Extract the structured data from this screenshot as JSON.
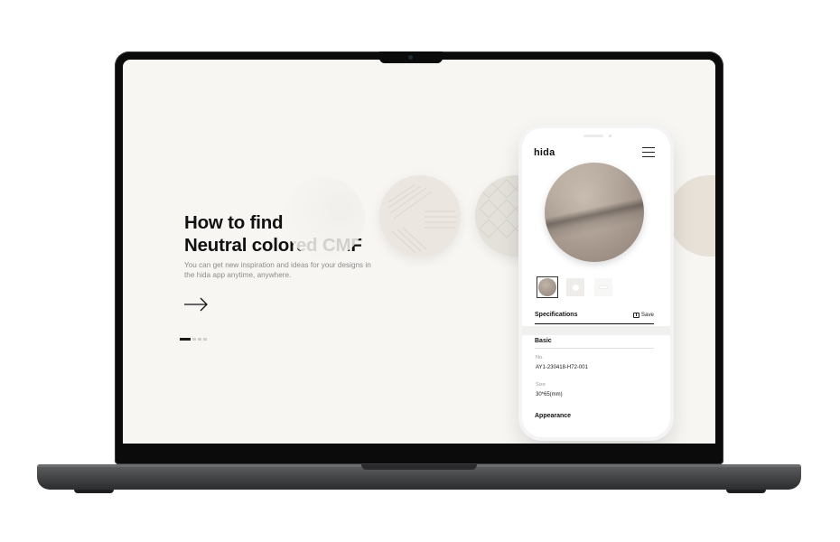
{
  "hero": {
    "title_line1": "How to find",
    "title_line2": "Neutral colored CMF",
    "subtitle": "You can get new inspiration and ideas for your designs in the hida app anytime, anywhere."
  },
  "carousel": {
    "total_slides": 4,
    "active_index": 0
  },
  "phone": {
    "logo": "hida",
    "specifications_label": "Specifications",
    "save_label": "Save",
    "basic_label": "Basic",
    "no_label": "No.",
    "no_value": "AY1-230418-H72-001",
    "size_label": "Size",
    "size_value": "30*65(mm)",
    "appearance_label": "Appearance"
  },
  "colors": {
    "background": "#f7f6f3",
    "text_primary": "#111111",
    "text_secondary": "#8c8c8c",
    "laptop_frame": "#0b0b0b",
    "laptop_base": "#4a4b4d"
  },
  "icons": [
    "arrow-right-icon",
    "menu-icon",
    "save-folder-icon"
  ]
}
